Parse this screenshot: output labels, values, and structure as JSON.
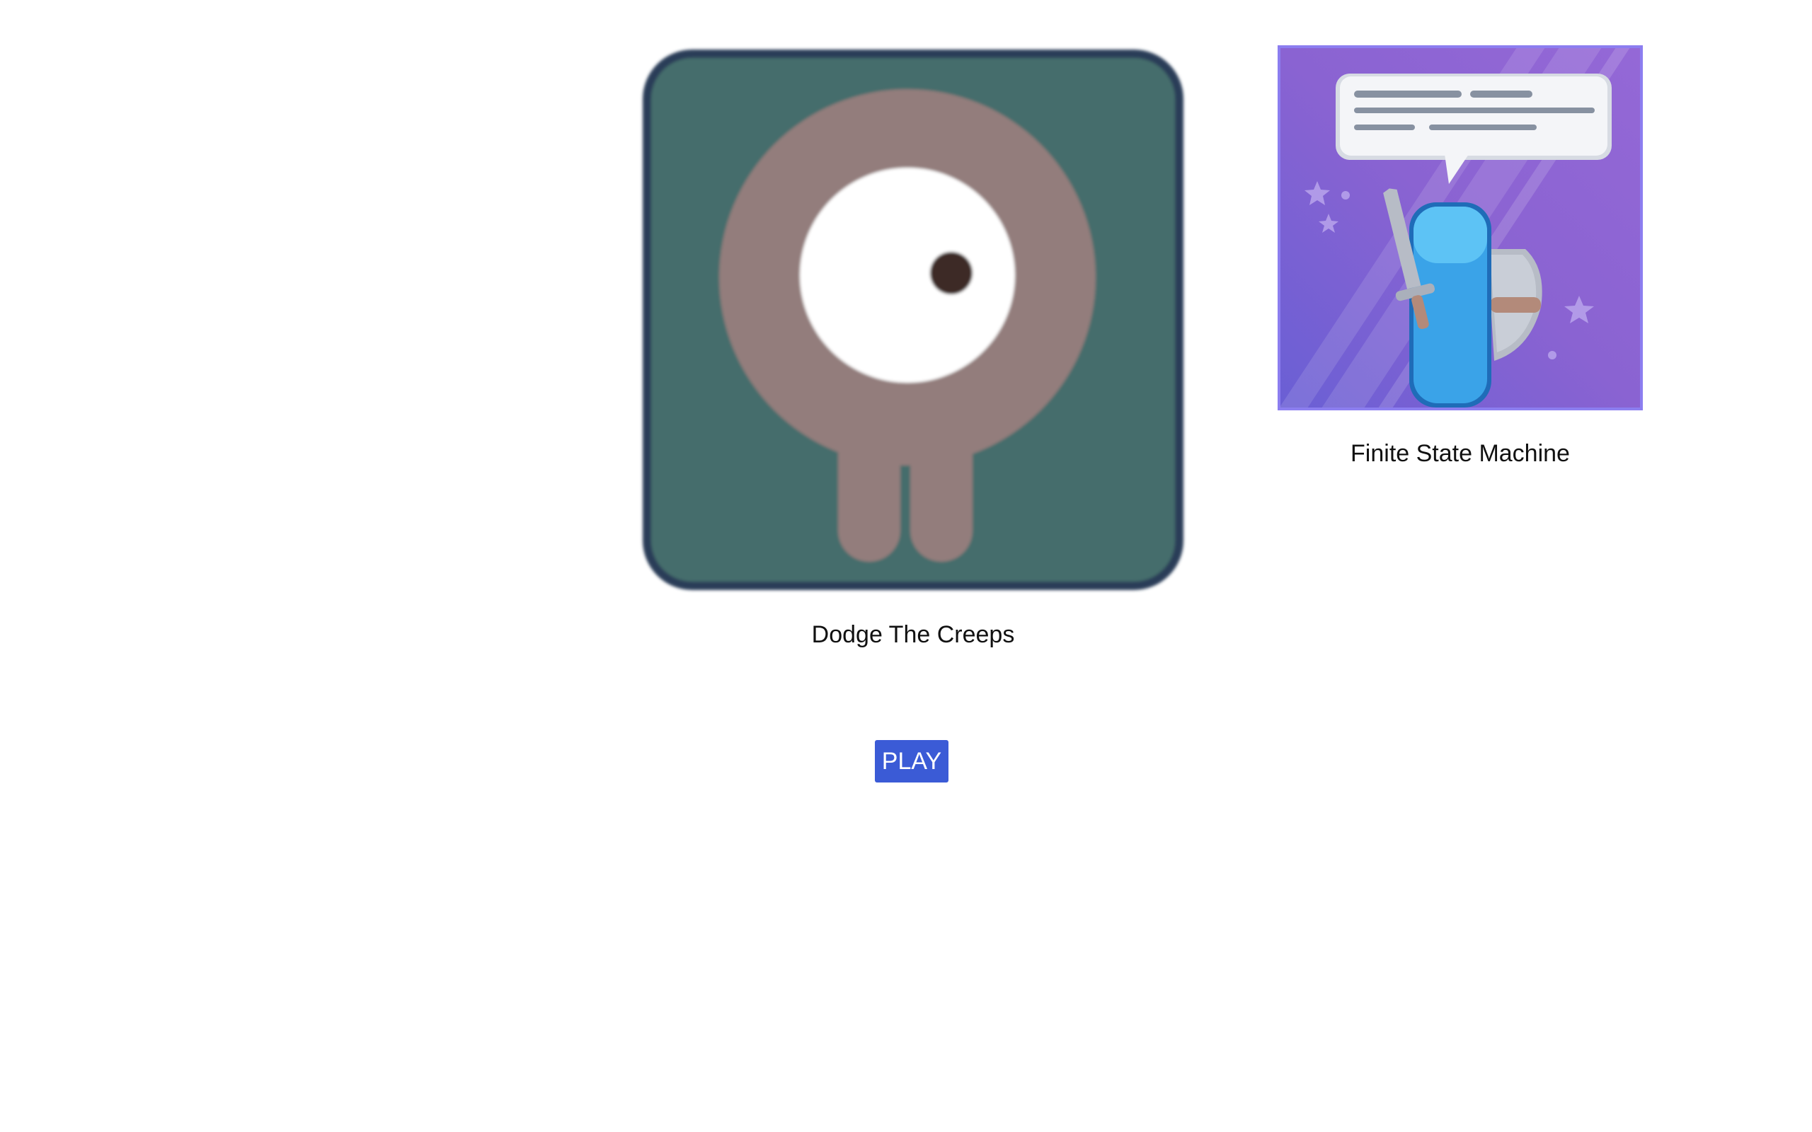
{
  "games": [
    {
      "title": "Dodge The Creeps",
      "icon": "creep-icon",
      "colors": {
        "background": "#456d6c",
        "border": "#2c3e58",
        "body": "#937d7b",
        "eye": "#ffffff",
        "pupil": "#3e2a28"
      }
    },
    {
      "title": "Finite State Machine",
      "icon": "knight-speech-icon",
      "colors": {
        "background": "#8a63d2",
        "border": "#8c7ef0",
        "bubble": "#f4f5f8",
        "character": "#3aa3e8",
        "sword": "#b7bcc6"
      }
    }
  ],
  "play_button": {
    "label": "PLAY",
    "color": "#3b5bd6"
  }
}
